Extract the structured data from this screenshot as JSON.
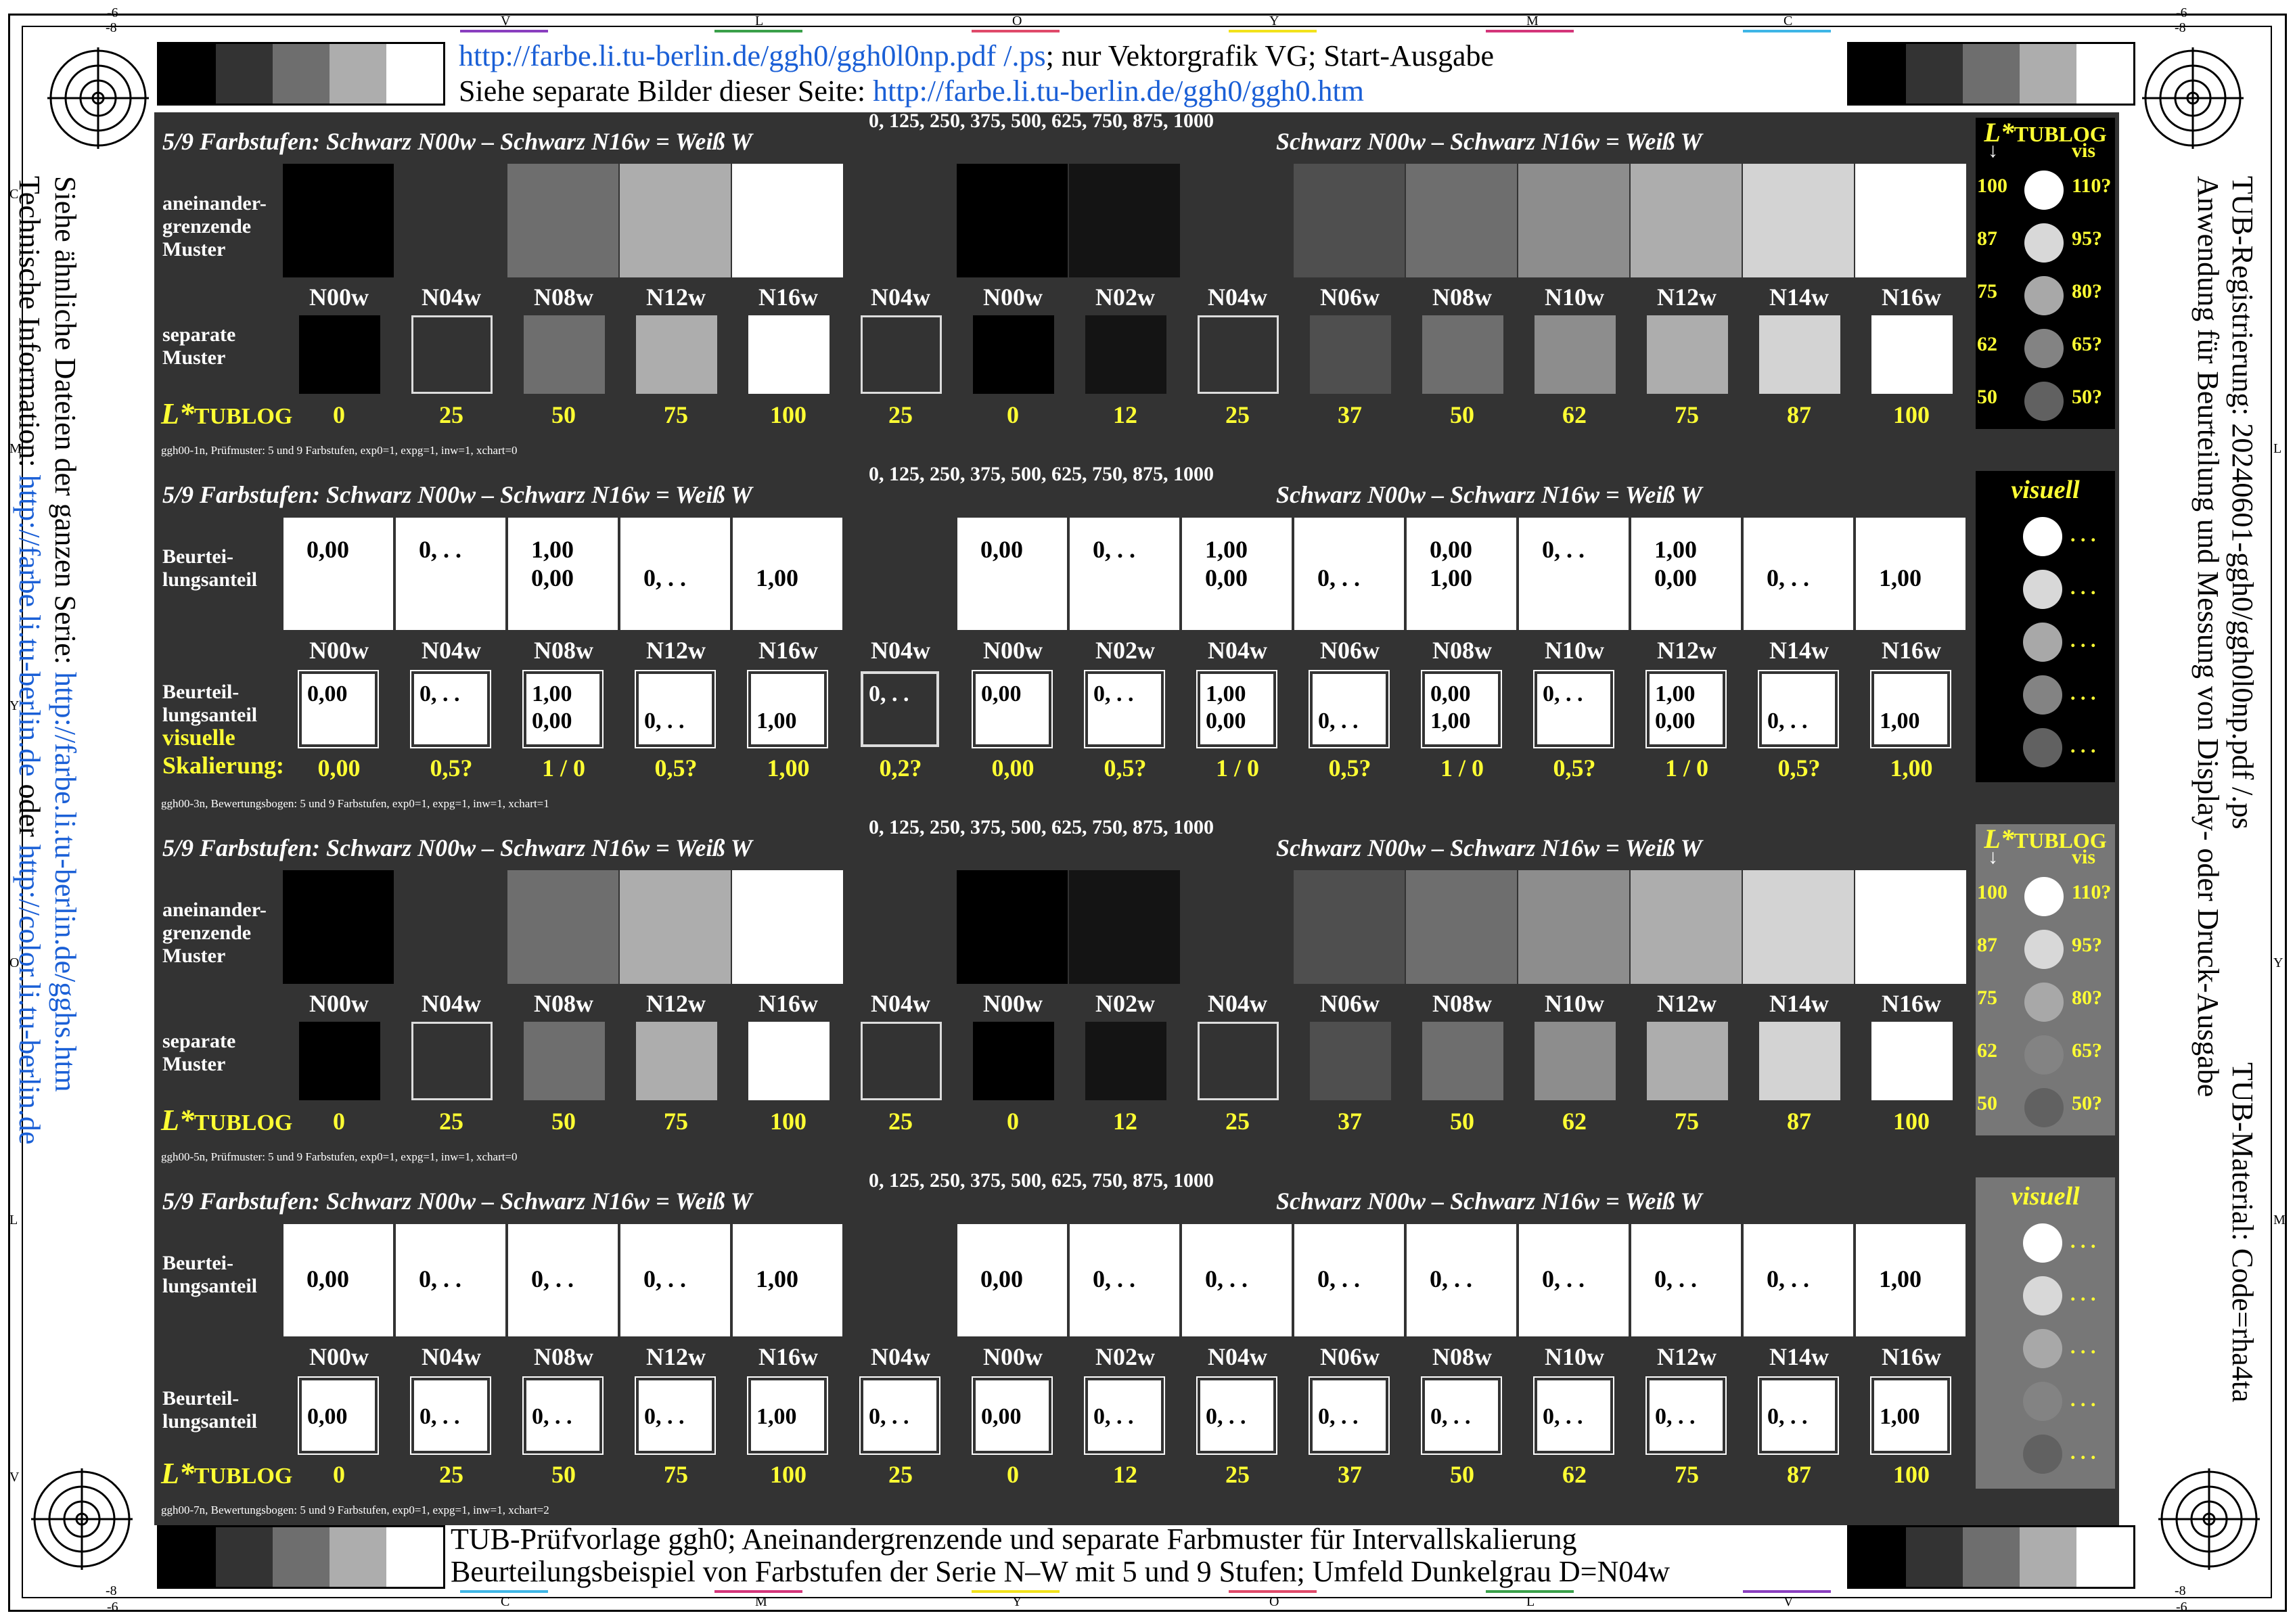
{
  "header": {
    "line1_link": "http://farbe.li.tu-berlin.de/ggh0/ggh0l0np.pdf /.ps",
    "line1_rest": "; nur Vektorgrafik VG; Start-Ausgabe",
    "line2_prefix": "Siehe separate Bilder dieser Seite: ",
    "line2_link": "http://farbe.li.tu-berlin.de/ggh0/ggh0.htm"
  },
  "footer": {
    "line1": "TUB-Prüfvorlage ggh0; Aneinandergrenzende und separate Farbmuster für Intervallskalierung",
    "line2": "Beurteilungsbeispiel von Farbstufen der Serie N–W mit 5 und 9 Stufen; Umfeld Dunkelgrau D=N04w"
  },
  "left_side": {
    "line1_prefix": "Siehe ähnliche Dateien der ganzen Serie: ",
    "line1_link": "http://farbe.li.tu-berlin.de/gghs.htm",
    "line2_prefix": "Technische Information: ",
    "line2_link1": "http://farbe.li.tu-berlin.de",
    "line2_mid": " oder ",
    "line2_link2": "http://color.li.tu-berlin.de"
  },
  "right_side": {
    "line1": "TUB-Registrierung: 20240601-ggh0/ggh0l0np.pdf /.ps",
    "line2": "Anwendung für Beurteilung und Messung von Display- oder Druck-Ausgabe",
    "line3": "TUB-Material: Code=rha4ta"
  },
  "ticks": {
    "top": [
      "V",
      "L",
      "O",
      "Y",
      "M",
      "C"
    ],
    "bottom": [
      "C",
      "M",
      "Y",
      "O",
      "L",
      "V"
    ],
    "left": [
      "C",
      "M",
      "Y",
      "O",
      "L",
      "V"
    ],
    "right": [
      "L",
      "Y",
      "M"
    ],
    "corner_top_left": [
      "-6",
      "-8"
    ],
    "corner_top_right": [
      "-6",
      "-8"
    ],
    "corner_bottom_left": [
      "-8",
      "-6"
    ],
    "corner_bottom_right": [
      "-8",
      "-6"
    ]
  },
  "common": {
    "title_left": "5/9 Farbstufen:  Schwarz N00w – Schwarz N16w = Weiß W",
    "title_right": "Schwarz N00w – Schwarz N16w = Weiß W",
    "numbers": "0, 125, 250, 375, 500, 625, 750, 875, 1000",
    "codes": [
      "N00w",
      "N04w",
      "N08w",
      "N12w",
      "N16w",
      "N04w",
      "N00w",
      "N02w",
      "N04w",
      "N06w",
      "N08w",
      "N10w",
      "N12w",
      "N14w",
      "N16w"
    ],
    "ltub": [
      "0",
      "25",
      "50",
      "75",
      "100",
      "25",
      "0",
      "12",
      "25",
      "37",
      "50",
      "62",
      "75",
      "87",
      "100"
    ],
    "ltub_label_main": "L*",
    "ltub_label_sub": "TUBLOG",
    "row_adj": "aneinander-\ngrenzende\nMuster",
    "row_sep": "separate\nMuster",
    "row_beurt": "Beurtei-\nlungsanteil",
    "row_beurt2": "Beurteil-\nlungsanteil",
    "row_visuelle": "visuelle",
    "row_skal": "Skalierung:",
    "side_header_main": "L*",
    "side_header_sub": "TUBLOG",
    "side_vis": "vis",
    "side_arrow": "↓",
    "side_visuell": "visuell",
    "dots": ". . .",
    "side_left": [
      "100",
      "87",
      "75",
      "62",
      "50"
    ],
    "side_right": [
      "110?",
      "95?",
      "80?",
      "65?",
      "50?"
    ]
  },
  "panel1": {
    "caption": "ggh00-1n, Prüfmuster: 5 und 9 Farbstufen, exp0=1, expg=1, inw=1, xchart=0"
  },
  "panel2": {
    "caption": "ggh00-3n, Bewertungsbogen: 5 und 9 Farbstufen, exp0=1, expg=1, inw=1, xchart=1",
    "big": [
      [
        "0,00",
        ""
      ],
      [
        "0, . .",
        ""
      ],
      [
        "1,00",
        "0,00"
      ],
      [
        "",
        "0, . ."
      ],
      [
        "",
        "1,00"
      ],
      [
        "",
        ""
      ],
      [
        "0,00",
        ""
      ],
      [
        "0, . .",
        ""
      ],
      [
        "1,00",
        "0,00"
      ],
      [
        "",
        "0, . ."
      ],
      [
        "0,00",
        "1,00"
      ],
      [
        "0, . .",
        ""
      ],
      [
        "1,00",
        "0,00"
      ],
      [
        "",
        "0, . ."
      ],
      [
        "",
        "1,00"
      ]
    ],
    "small": [
      [
        "0,00",
        ""
      ],
      [
        "0, . .",
        ""
      ],
      [
        "1,00",
        "0,00"
      ],
      [
        "",
        "0, . ."
      ],
      [
        "",
        "1,00"
      ],
      [
        "0, . .",
        ""
      ],
      [
        "0,00",
        ""
      ],
      [
        "0, . .",
        ""
      ],
      [
        "1,00",
        "0,00"
      ],
      [
        "",
        "0, . ."
      ],
      [
        "0,00",
        "1,00"
      ],
      [
        "0, . .",
        ""
      ],
      [
        "1,00",
        "0,00"
      ],
      [
        "",
        "0, . ."
      ],
      [
        "",
        "1,00"
      ]
    ],
    "skal": [
      "0,00",
      "0,5?",
      "1 / 0",
      "0,5?",
      "1,00",
      "0,2?",
      "0,00",
      "0,5?",
      "1 / 0",
      "0,5?",
      "1 / 0",
      "0,5?",
      "1 / 0",
      "0,5?",
      "1,00"
    ]
  },
  "panel3": {
    "caption": "ggh00-5n, Prüfmuster: 5 und 9 Farbstufen, exp0=1, expg=1, inw=1, xchart=0"
  },
  "panel4": {
    "caption": "ggh00-7n, Bewertungsbogen: 5 und 9 Farbstufen, exp0=1, expg=1, inw=1, xchart=2",
    "big": [
      "0,00",
      "0, . .",
      "0, . .",
      "0, . .",
      "1,00",
      "",
      "0,00",
      "0, . .",
      "0, . .",
      "0, . .",
      "0, . .",
      "0, . .",
      "0, . .",
      "0, . .",
      "1,00"
    ],
    "small": [
      "0,00",
      "0, . .",
      "0, . .",
      "0, . .",
      "1,00",
      "0, . .",
      "0,00",
      "0, . .",
      "0, . .",
      "0, . .",
      "0, . .",
      "0, . .",
      "0, . .",
      "0, . .",
      "1,00"
    ]
  },
  "colors": {
    "panel_bg": "#333333",
    "side_bg_dark": "#000000",
    "side_bg_grey": "#777777",
    "yellow": "#ffff33",
    "link": "#1a5fd6",
    "tiles": [
      "#000000",
      "#333333",
      "#6e6e6e",
      "#adadad",
      "#ffffff",
      "#333333",
      "#000000",
      "#141414",
      "#333333",
      "#4f4f4f",
      "#6e6e6e",
      "#8d8d8d",
      "#adadad",
      "#d3d3d3",
      "#ffffff"
    ],
    "side_circles": [
      "#ffffff",
      "#d8d8d8",
      "#a8a8a8",
      "#838383",
      "#616161"
    ],
    "strip": [
      "#000000",
      "#333333",
      "#6e6e6e",
      "#adadad",
      "#ffffff"
    ]
  }
}
